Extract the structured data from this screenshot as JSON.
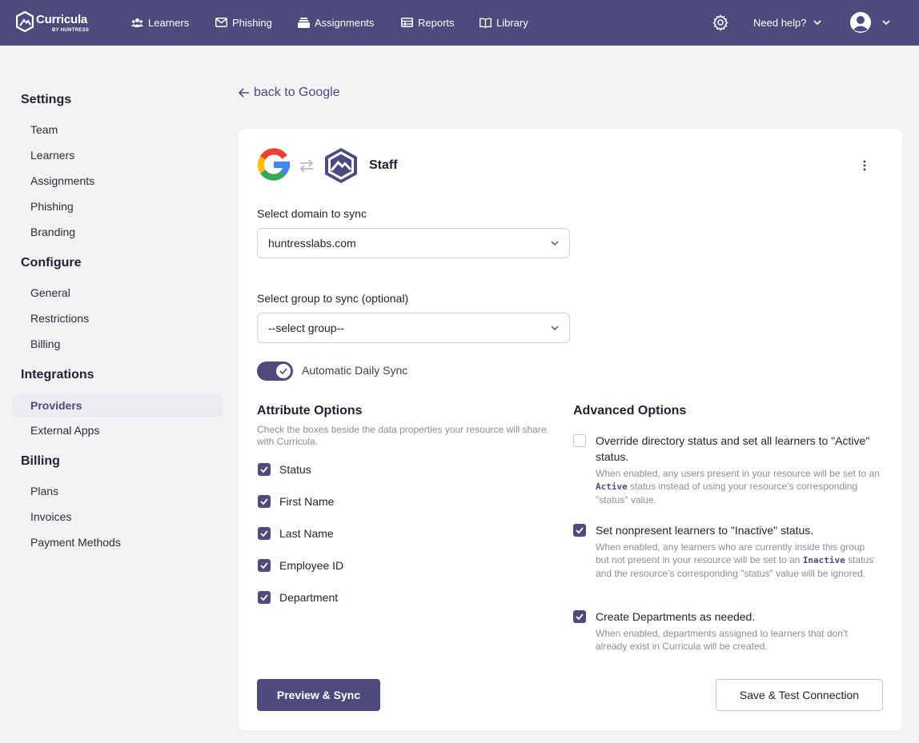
{
  "brand": {
    "name": "Curricula",
    "byline": "BY HUNTRESS",
    "accent_color": "#4d4b7c"
  },
  "topnav": {
    "items": [
      {
        "label": "Learners",
        "icon": "users-icon"
      },
      {
        "label": "Phishing",
        "icon": "mail-icon"
      },
      {
        "label": "Assignments",
        "icon": "stack-icon"
      },
      {
        "label": "Reports",
        "icon": "table-icon"
      },
      {
        "label": "Library",
        "icon": "book-icon"
      }
    ],
    "help_label": "Need help?"
  },
  "sidebar": {
    "sections": [
      {
        "heading": "Settings",
        "items": [
          "Team",
          "Learners",
          "Assignments",
          "Phishing",
          "Branding"
        ]
      },
      {
        "heading": "Configure",
        "items": [
          "General",
          "Restrictions",
          "Billing"
        ]
      },
      {
        "heading": "Integrations",
        "items": [
          "Providers",
          "External Apps"
        ]
      },
      {
        "heading": "Billing",
        "items": [
          "Plans",
          "Invoices",
          "Payment Methods"
        ]
      }
    ],
    "active_item": "Providers"
  },
  "back_link": "back to Google",
  "card": {
    "title": "Staff",
    "domain": {
      "label": "Select domain to sync",
      "value": "huntresslabs.com"
    },
    "group": {
      "label": "Select group to sync (optional)",
      "value": "--select group--"
    },
    "auto_sync": {
      "label": "Automatic Daily Sync",
      "enabled": true
    },
    "attribute_options": {
      "title": "Attribute Options",
      "description": "Check the boxes beside the data properties your resource will share with Curricula.",
      "items": [
        {
          "label": "Status",
          "checked": true
        },
        {
          "label": "First Name",
          "checked": true
        },
        {
          "label": "Last Name",
          "checked": true
        },
        {
          "label": "Employee ID",
          "checked": true
        },
        {
          "label": "Department",
          "checked": true
        }
      ]
    },
    "advanced_options": {
      "title": "Advanced Options",
      "items": [
        {
          "title": "Override directory status and set all learners to \"Active\" status.",
          "checked": false,
          "desc_before": "When enabled, any users present in your resource will be set to an ",
          "desc_code": "Active",
          "desc_after": " status instead of using your resource’s corresponding \"status\" value."
        },
        {
          "title": "Set nonpresent learners to \"Inactive\" status.",
          "checked": true,
          "desc_before": "When enabled, any learners who are currently inside this group but not present in your resource will be set to an ",
          "desc_code": "Inactive",
          "desc_after": " status and the resource’s corresponding \"status\" value will be ignored."
        },
        {
          "title": "Create Departments as needed.",
          "checked": true,
          "desc_before": "When enabled, departments assigned to learners that don’t already exist in Curricula will be created.",
          "desc_code": "",
          "desc_after": ""
        }
      ]
    },
    "buttons": {
      "preview": "Preview & Sync",
      "save": "Save & Test Connection"
    }
  }
}
